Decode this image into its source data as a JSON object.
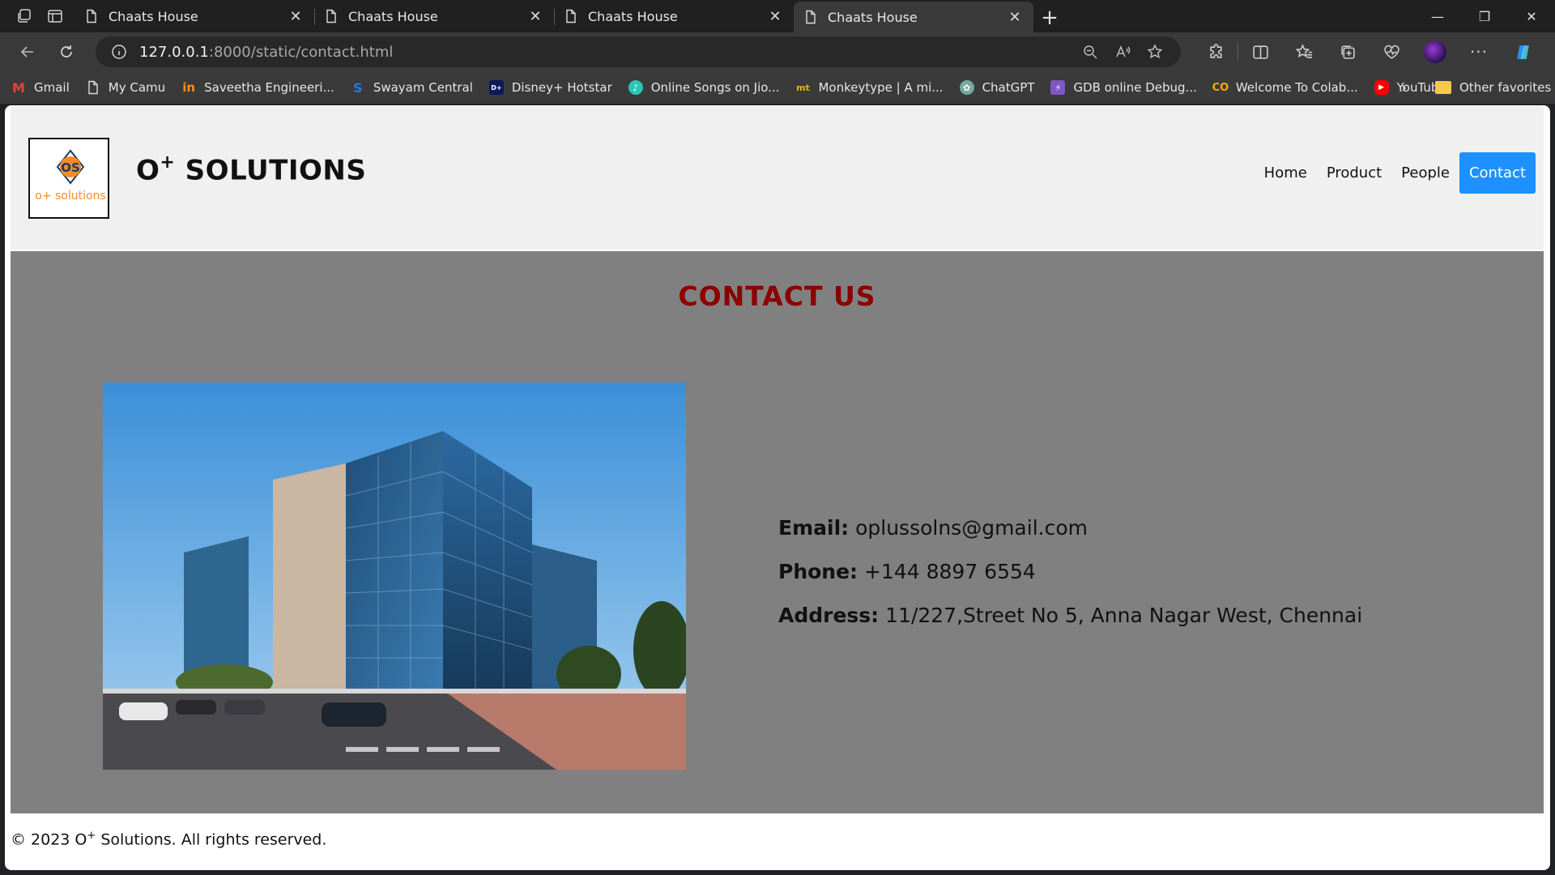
{
  "browser": {
    "tabs": [
      {
        "title": "Chaats House",
        "active": false
      },
      {
        "title": "Chaats House",
        "active": false
      },
      {
        "title": "Chaats House",
        "active": false
      },
      {
        "title": "Chaats House",
        "active": true
      }
    ],
    "url_host": "127.0.0.1",
    "url_path": ":8000/static/contact.html",
    "bookmarks": [
      {
        "label": "Gmail",
        "icon": "gmail-icon",
        "color": "#ea4335"
      },
      {
        "label": "My Camu",
        "icon": "page-icon",
        "color": "#3a3a3a"
      },
      {
        "label": "Saveetha Engineeri...",
        "icon": "saveetha-icon",
        "color": "#f29111"
      },
      {
        "label": "Swayam Central",
        "icon": "swayam-icon",
        "color": "#1f7ae0"
      },
      {
        "label": "Disney+ Hotstar",
        "icon": "hotstar-icon",
        "color": "#0c1a5a"
      },
      {
        "label": "Online Songs on Jio...",
        "icon": "jiosaavn-icon",
        "color": "#2bc5b4"
      },
      {
        "label": "Monkeytype | A mi...",
        "icon": "monkeytype-icon",
        "color": "#e2b714"
      },
      {
        "label": "ChatGPT",
        "icon": "chatgpt-icon",
        "color": "#74aa9c"
      },
      {
        "label": "GDB online Debug...",
        "icon": "gdb-icon",
        "color": "#7e57c2"
      },
      {
        "label": "Welcome To Colab...",
        "icon": "colab-icon",
        "color": "#f9ab00"
      },
      {
        "label": "YouTube",
        "icon": "youtube-icon",
        "color": "#ff0000"
      }
    ],
    "other_favorites": "Other favorites"
  },
  "site": {
    "logo_text": "o+ solutions",
    "logo_mark": "OS",
    "brand_main": "O",
    "brand_sup": "+",
    "brand_rest": " SOLUTIONS",
    "nav": [
      {
        "label": "Home",
        "active": false
      },
      {
        "label": "Product",
        "active": false
      },
      {
        "label": "People",
        "active": false
      },
      {
        "label": "Contact",
        "active": true
      }
    ],
    "accent_color": "#1e90ff"
  },
  "contact": {
    "title": "CONTACT US",
    "title_color": "#8b0000",
    "email_label": "Email:",
    "email_value": " oplussolns@gmail.com",
    "phone_label": "Phone:",
    "phone_value": " +144 8897 6554",
    "address_label": "Address:",
    "address_value": " 11/227,Street No 5, Anna Nagar West, Chennai"
  },
  "footer": {
    "prefix": "© 2023 O",
    "sup": "+",
    "suffix": " Solutions. All rights reserved."
  }
}
